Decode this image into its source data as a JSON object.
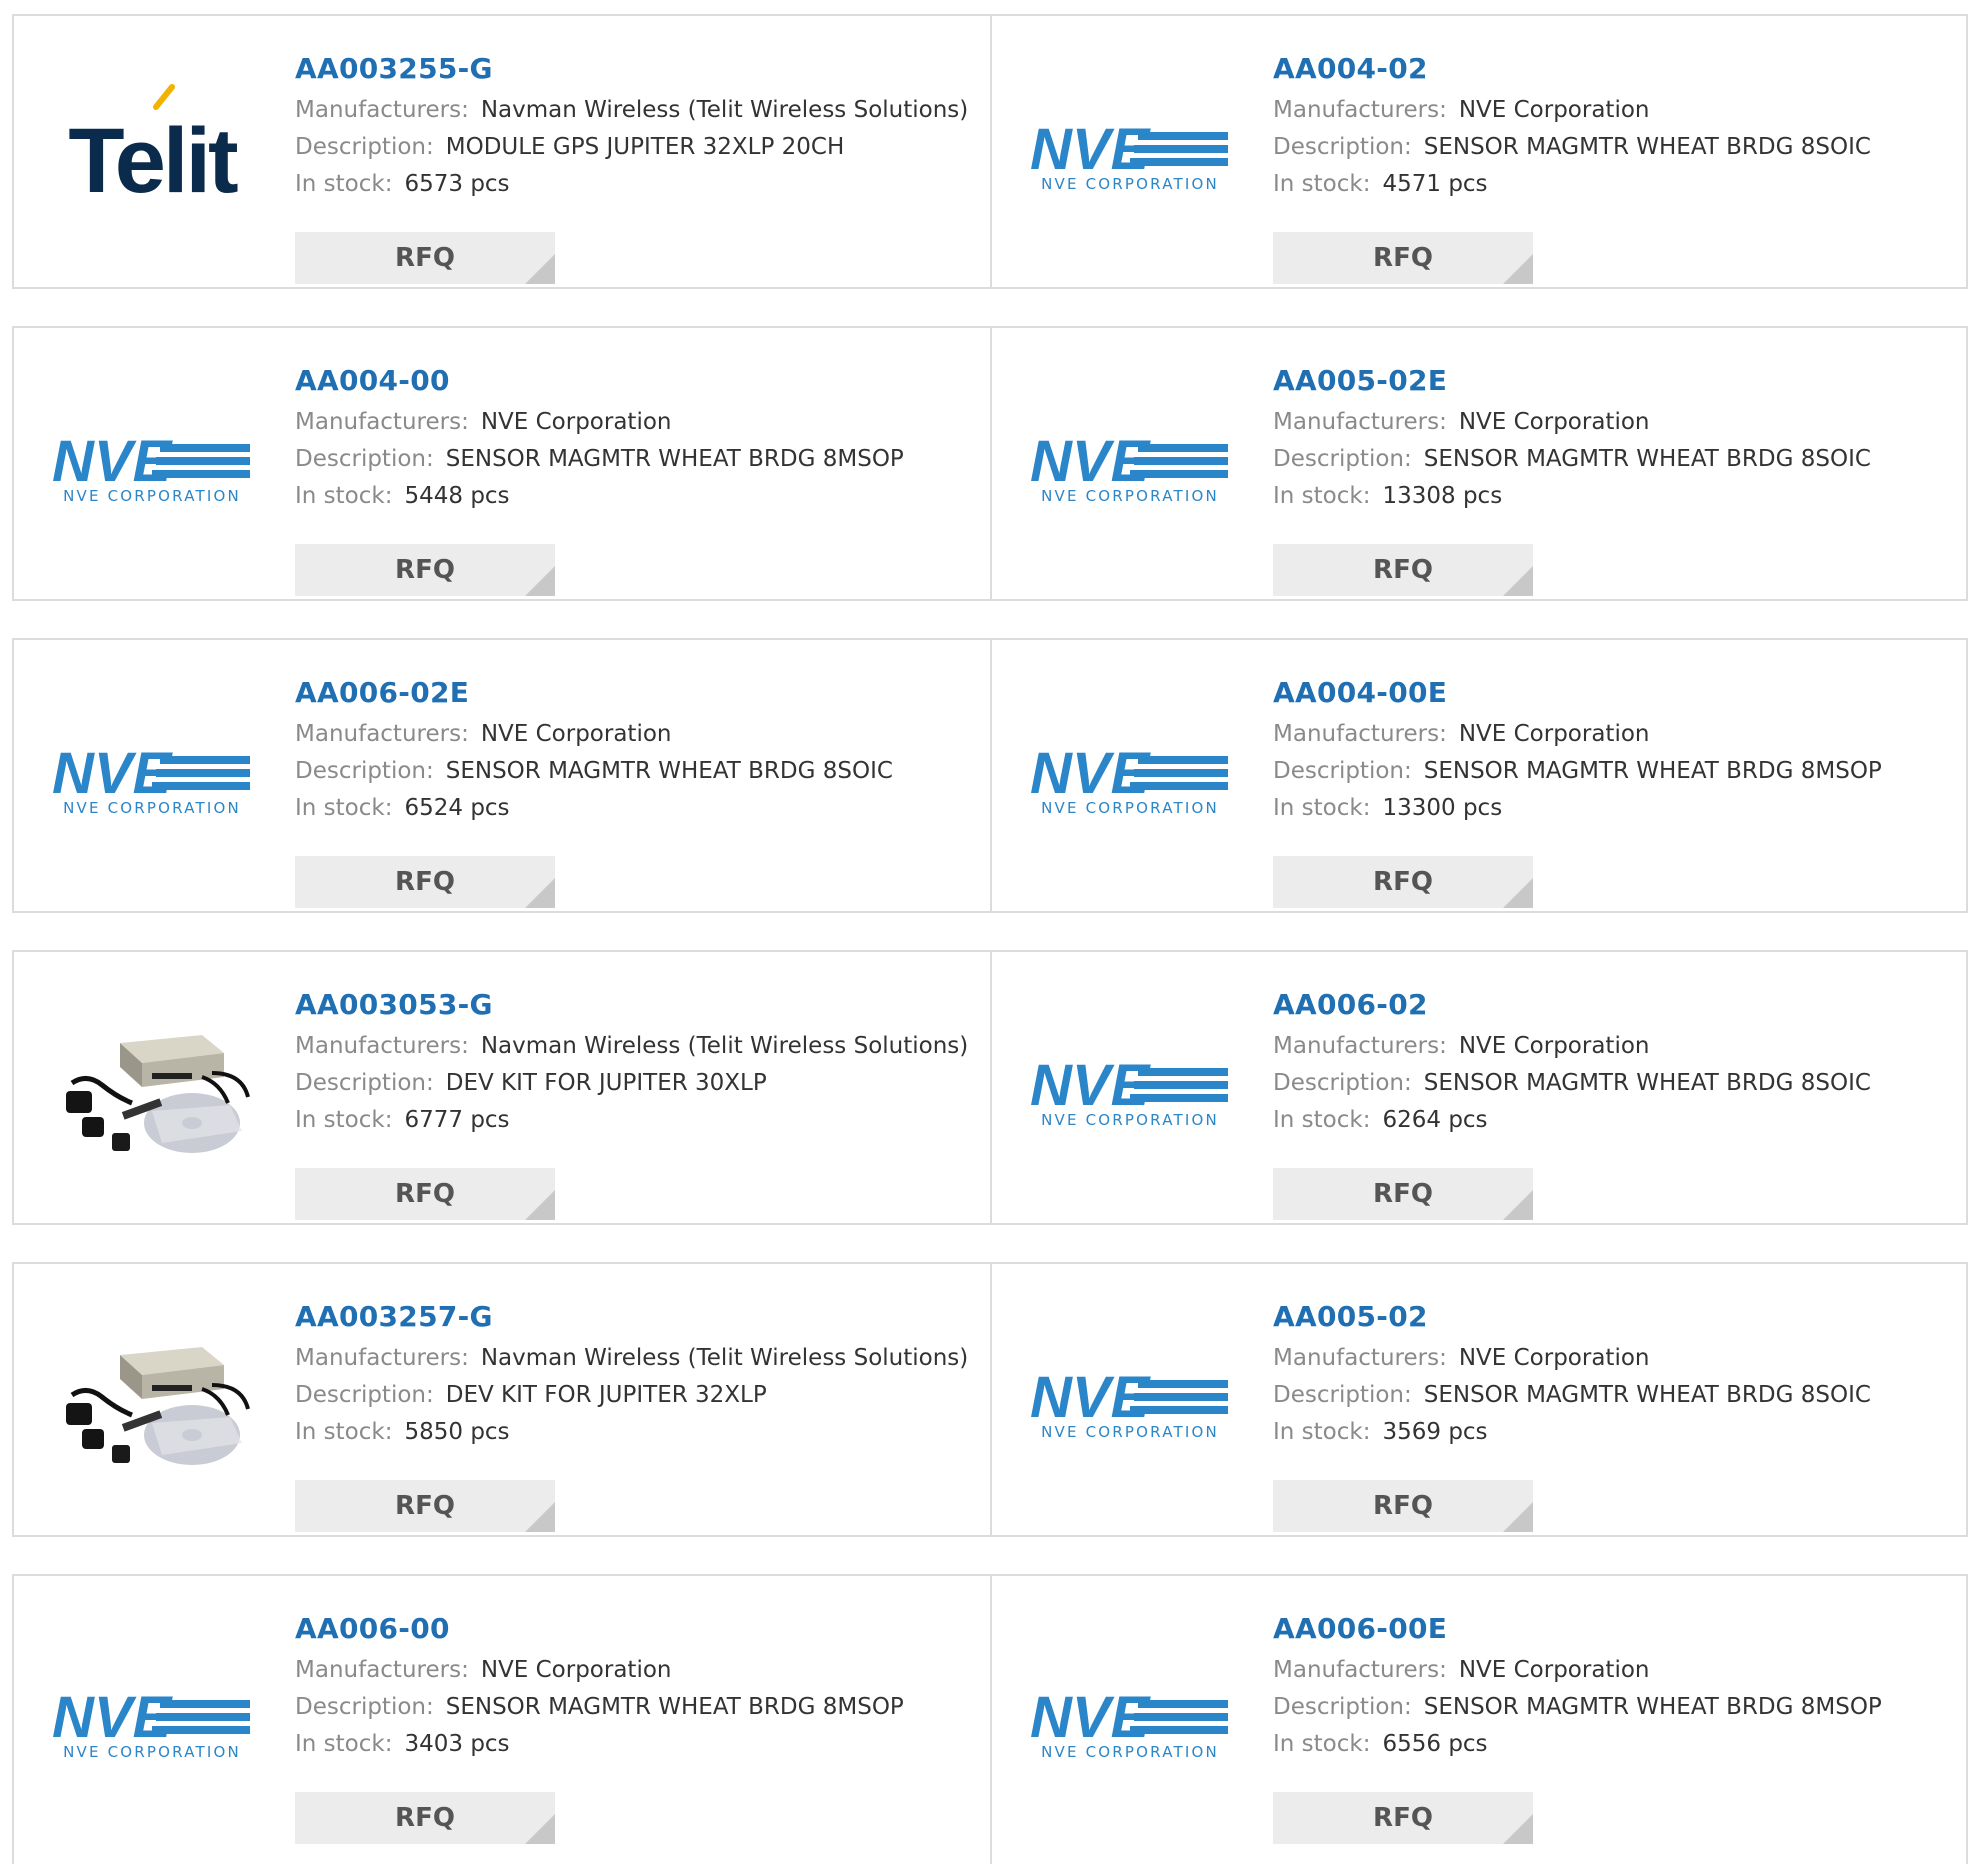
{
  "labels": {
    "manufacturers": "Manufacturers:",
    "description": "Description:",
    "in_stock": "In stock:",
    "rfq": "RFQ"
  },
  "logos": {
    "telit": {
      "text": "Telit",
      "color": "#0b2b4c",
      "accent": "#f2b300"
    },
    "nve": {
      "text": "NVE",
      "subtext": "NVE CORPORATION",
      "color": "#2a86c8"
    }
  },
  "products": [
    {
      "part": "AA003255-G",
      "manufacturer": "Navman Wireless (Telit Wireless Solutions)",
      "description": "MODULE GPS JUPITER 32XLP 20CH",
      "stock": "6573 pcs",
      "logo": "telit"
    },
    {
      "part": "AA004-02",
      "manufacturer": "NVE Corporation",
      "description": "SENSOR MAGMTR WHEAT BRDG 8SOIC",
      "stock": "4571 pcs",
      "logo": "nve"
    },
    {
      "part": "AA004-00",
      "manufacturer": "NVE Corporation",
      "description": "SENSOR MAGMTR WHEAT BRDG 8MSOP",
      "stock": "5448 pcs",
      "logo": "nve"
    },
    {
      "part": "AA005-02E",
      "manufacturer": "NVE Corporation",
      "description": "SENSOR MAGMTR WHEAT BRDG 8SOIC",
      "stock": "13308 pcs",
      "logo": "nve"
    },
    {
      "part": "AA006-02E",
      "manufacturer": "NVE Corporation",
      "description": "SENSOR MAGMTR WHEAT BRDG 8SOIC",
      "stock": "6524 pcs",
      "logo": "nve"
    },
    {
      "part": "AA004-00E",
      "manufacturer": "NVE Corporation",
      "description": "SENSOR MAGMTR WHEAT BRDG 8MSOP",
      "stock": "13300 pcs",
      "logo": "nve"
    },
    {
      "part": "AA003053-G",
      "manufacturer": "Navman Wireless (Telit Wireless Solutions)",
      "description": "DEV KIT FOR JUPITER 30XLP",
      "stock": "6777 pcs",
      "logo": "devkit"
    },
    {
      "part": "AA006-02",
      "manufacturer": "NVE Corporation",
      "description": "SENSOR MAGMTR WHEAT BRDG 8SOIC",
      "stock": "6264 pcs",
      "logo": "nve"
    },
    {
      "part": "AA003257-G",
      "manufacturer": "Navman Wireless (Telit Wireless Solutions)",
      "description": "DEV KIT FOR JUPITER 32XLP",
      "stock": "5850 pcs",
      "logo": "devkit"
    },
    {
      "part": "AA005-02",
      "manufacturer": "NVE Corporation",
      "description": "SENSOR MAGMTR WHEAT BRDG 8SOIC",
      "stock": "3569 pcs",
      "logo": "nve"
    },
    {
      "part": "AA006-00",
      "manufacturer": "NVE Corporation",
      "description": "SENSOR MAGMTR WHEAT BRDG 8MSOP",
      "stock": "3403 pcs",
      "logo": "nve"
    },
    {
      "part": "AA006-00E",
      "manufacturer": "NVE Corporation",
      "description": "SENSOR MAGMTR WHEAT BRDG 8MSOP",
      "stock": "6556 pcs",
      "logo": "nve"
    }
  ]
}
